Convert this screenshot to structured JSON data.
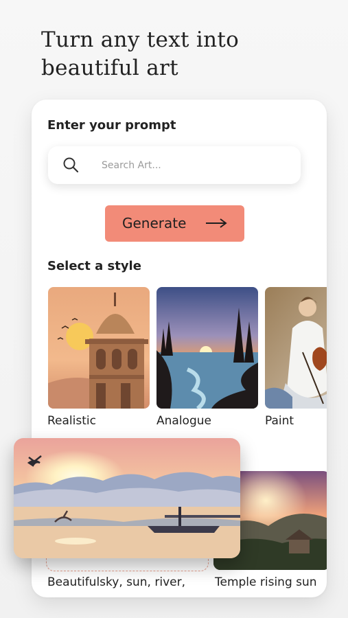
{
  "headline": {
    "line1": "Turn any text into",
    "line2": "beautiful art"
  },
  "prompt": {
    "label": "Enter your prompt",
    "search_placeholder": "Search Art...",
    "search_value": ""
  },
  "generate": {
    "label": "Generate"
  },
  "styles": {
    "label": "Select a style",
    "items": [
      {
        "label": "Realistic"
      },
      {
        "label": "Analogue"
      },
      {
        "label": "Paint"
      }
    ]
  },
  "examples": {
    "items": [
      {
        "label": "Beautifulsky, sun, river,"
      },
      {
        "label": "Temple rising sun"
      }
    ]
  },
  "colors": {
    "accent": "#f28b78",
    "text": "#222222",
    "card": "#ffffff"
  }
}
